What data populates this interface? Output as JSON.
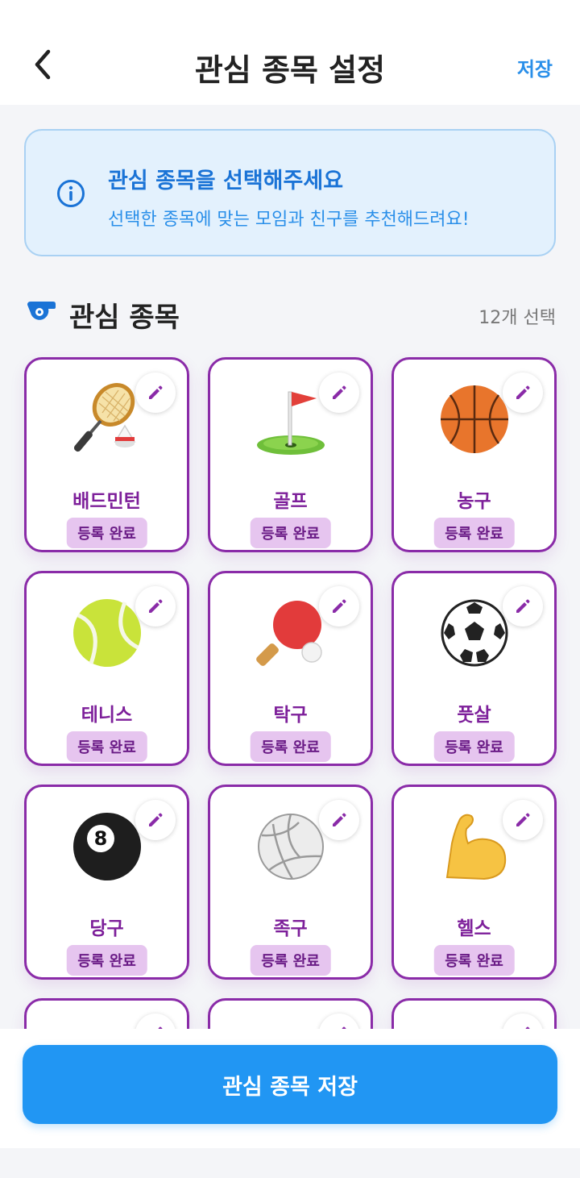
{
  "header": {
    "title": "관심 종목 설정",
    "save_label": "저장"
  },
  "notice": {
    "title": "관심 종목을 선택해주세요",
    "subtitle": "선택한 종목에 맞는 모임과 친구를 추천해드려요!"
  },
  "section": {
    "title": "관심 종목",
    "count": "12개 선택"
  },
  "sports": [
    {
      "name": "배드민턴",
      "status": "등록 완료",
      "icon": "badminton-icon"
    },
    {
      "name": "골프",
      "status": "등록 완료",
      "icon": "golf-icon"
    },
    {
      "name": "농구",
      "status": "등록 완료",
      "icon": "basketball-icon"
    },
    {
      "name": "테니스",
      "status": "등록 완료",
      "icon": "tennis-icon"
    },
    {
      "name": "탁구",
      "status": "등록 완료",
      "icon": "table-tennis-icon"
    },
    {
      "name": "풋살",
      "status": "등록 완료",
      "icon": "soccer-ball-icon"
    },
    {
      "name": "당구",
      "status": "등록 완료",
      "icon": "billiards-icon"
    },
    {
      "name": "족구",
      "status": "등록 완료",
      "icon": "volleyball-icon"
    },
    {
      "name": "헬스",
      "status": "등록 완료",
      "icon": "flexed-biceps-icon"
    }
  ],
  "footer": {
    "button_label": "관심 종목 저장"
  },
  "colors": {
    "accent": "#2196f3",
    "card_border": "#8a2ba8",
    "badge_bg": "#e6c5ef"
  }
}
